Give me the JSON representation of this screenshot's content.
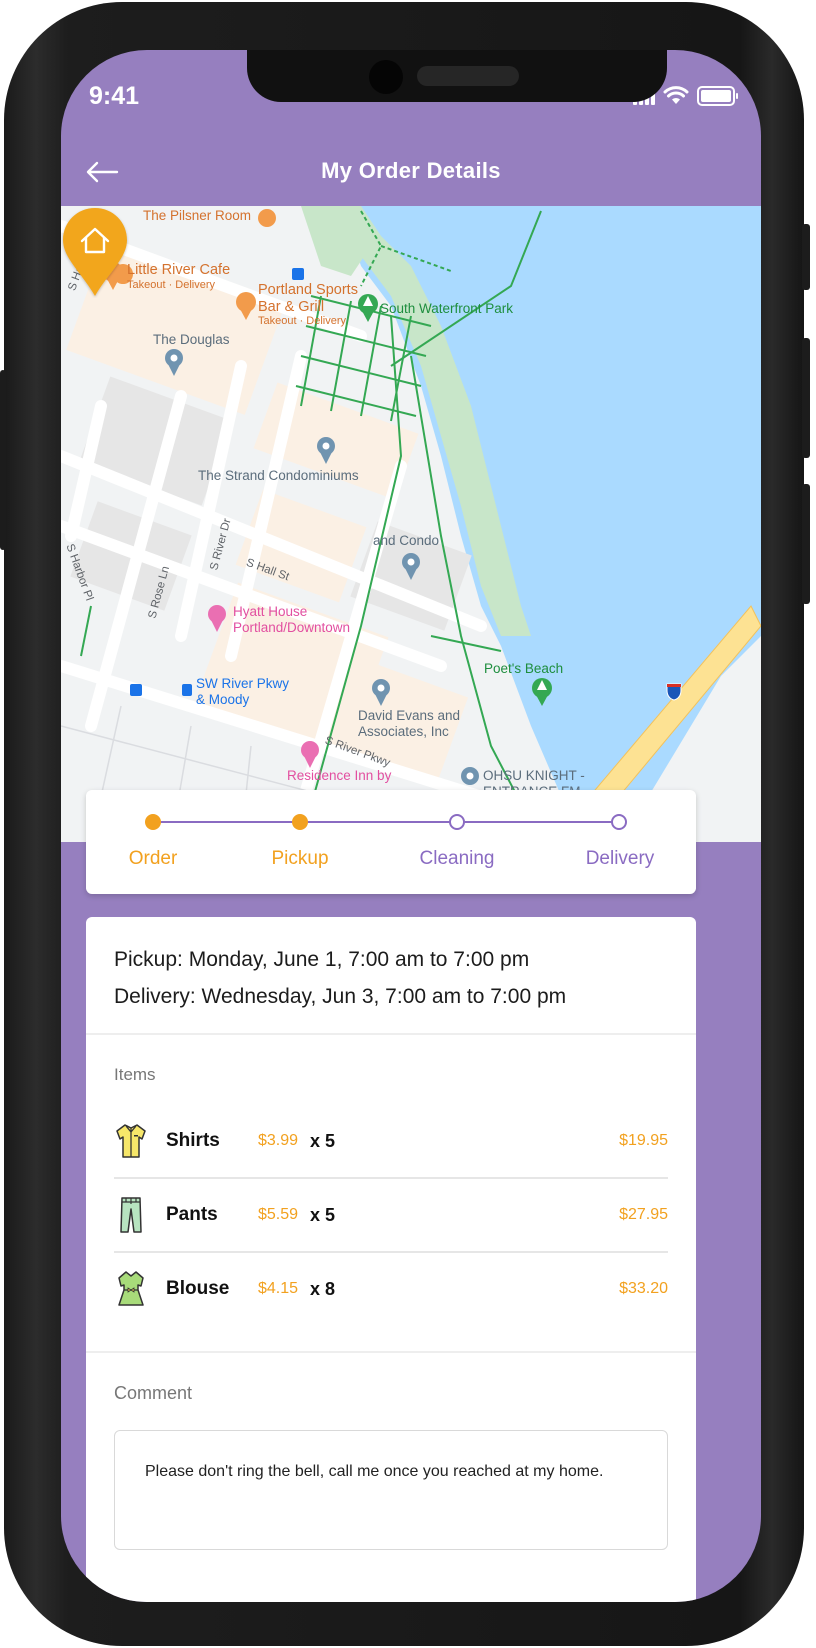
{
  "status_bar": {
    "time": "9:41",
    "icons": [
      "signal-icon",
      "wifi-icon",
      "battery-icon"
    ]
  },
  "header": {
    "back_icon": "arrow-left-icon",
    "title": "My Order Details"
  },
  "map": {
    "labels": {
      "pilsner": "The Pilsner Room",
      "little_river": "Little River Cafe",
      "little_river_sub": "Takeout · Delivery",
      "portland_sports_1": "Portland Sports",
      "portland_sports_2": "Bar & Grill",
      "portland_sports_sub": "Takeout · Delivery",
      "south_waterfront": "South Waterfront Park",
      "douglas": "The Douglas",
      "strand": "The Strand Condominiums",
      "strand_condo": "and Condo",
      "hyatt_1": "Hyatt House",
      "hyatt_2": "Portland/Downtown",
      "poets_beach": "Poet's Beach",
      "sw_river_1": "SW River Pkwy",
      "sw_river_2": "& Moody",
      "david_evans_1": "David Evans and",
      "david_evans_2": "Associates, Inc",
      "residence_inn": "Residence Inn by",
      "ohsu_1": "OHSU KNIGHT -",
      "ohsu_2": "ENTRANCE FM",
      "s_harbor_pl_1": "S Harbor Pl",
      "s_harbor_pl_2": "S Harbor Pl",
      "s_river_dr": "S River Dr",
      "s_rose_ln": "S Rose Ln",
      "s_hall_st": "S Hall St",
      "s_river_pkwy": "S River Pkwy",
      "interstate": "5"
    },
    "marker": "home-pin-icon"
  },
  "progress": {
    "steps": [
      {
        "label": "Order",
        "state": "done"
      },
      {
        "label": "Pickup",
        "state": "done"
      },
      {
        "label": "Cleaning",
        "state": "todo"
      },
      {
        "label": "Delivery",
        "state": "todo"
      }
    ],
    "colors": {
      "done": "#f2a11f",
      "todo": "#8a6bc2"
    }
  },
  "schedule": {
    "pickup": "Pickup:  Monday, June 1, 7:00 am to 7:00 pm",
    "delivery": "Delivery: Wednesday, Jun 3, 7:00 am to 7:00 pm"
  },
  "items": {
    "label": "Items",
    "rows": [
      {
        "icon": "shirt-icon",
        "name": "Shirts",
        "price": "$3.99",
        "qty": "x 5",
        "total": "$19.95"
      },
      {
        "icon": "pants-icon",
        "name": "Pants",
        "price": "$5.59",
        "qty": "x 5",
        "total": "$27.95"
      },
      {
        "icon": "blouse-icon",
        "name": "Blouse",
        "price": "$4.15",
        "qty": "x 8",
        "total": "$33.20"
      }
    ]
  },
  "comment": {
    "label": "Comment",
    "text": "Please don't ring the bell, call me once you reached at my home."
  },
  "theme": {
    "primary": "#967fbf",
    "accent": "#f2a11f"
  }
}
